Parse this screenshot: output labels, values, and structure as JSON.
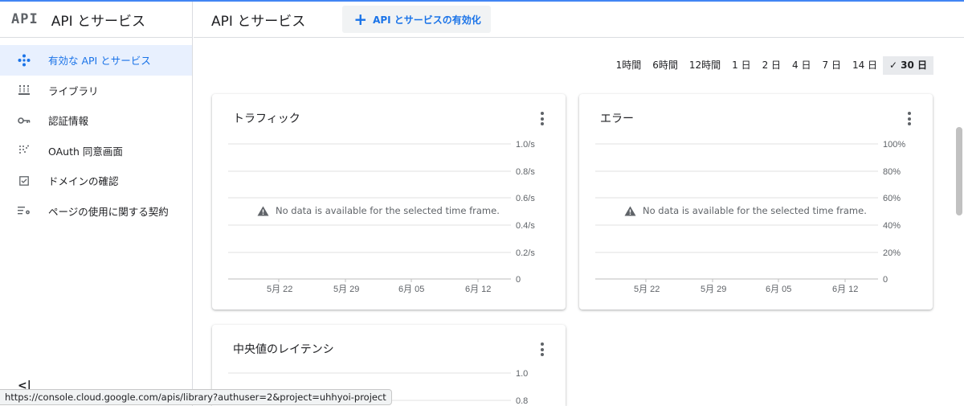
{
  "sidebar": {
    "logo": "API",
    "title": "API とサービス",
    "items": [
      {
        "label": "有効な API とサービス",
        "icon": "diamond-dots-icon"
      },
      {
        "label": "ライブラリ",
        "icon": "library-icon"
      },
      {
        "label": "認証情報",
        "icon": "key-icon"
      },
      {
        "label": "OAuth 同意画面",
        "icon": "consent-dots-icon"
      },
      {
        "label": "ドメインの確認",
        "icon": "checkbox-icon"
      },
      {
        "label": "ページの使用に関する契約",
        "icon": "list-settings-icon"
      }
    ],
    "collapse_label": "<|"
  },
  "header": {
    "title": "API とサービス",
    "enable_button": "API とサービスの有効化"
  },
  "time_range": {
    "options": [
      "1時間",
      "6時間",
      "12時間",
      "1 日",
      "2 日",
      "4 日",
      "7 日",
      "14 日",
      "30 日"
    ],
    "selected": "30 日"
  },
  "status_url": "https://console.cloud.google.com/apis/library?authuser=2&project=uhhyoi-project",
  "colors": {
    "accent": "#1a73e8",
    "active_bg": "#e8f0fe",
    "grid": "#e0e0e0"
  },
  "charts": {
    "traffic": {
      "title": "トラフィック",
      "message": "No data is available for the selected time frame.",
      "yticks": [
        "1.0/s",
        "0.8/s",
        "0.6/s",
        "0.4/s",
        "0.2/s",
        "0"
      ],
      "xticks": [
        "5月 22",
        "5月 29",
        "6月 05",
        "6月 12"
      ]
    },
    "errors": {
      "title": "エラー",
      "message": "No data is available for the selected time frame.",
      "yticks": [
        "100%",
        "80%",
        "60%",
        "40%",
        "20%",
        "0"
      ],
      "xticks": [
        "5月 22",
        "5月 29",
        "6月 05",
        "6月 12"
      ]
    },
    "latency": {
      "title": "中央値のレイテンシ",
      "yticks": [
        "1.0",
        "0.8"
      ]
    }
  }
}
